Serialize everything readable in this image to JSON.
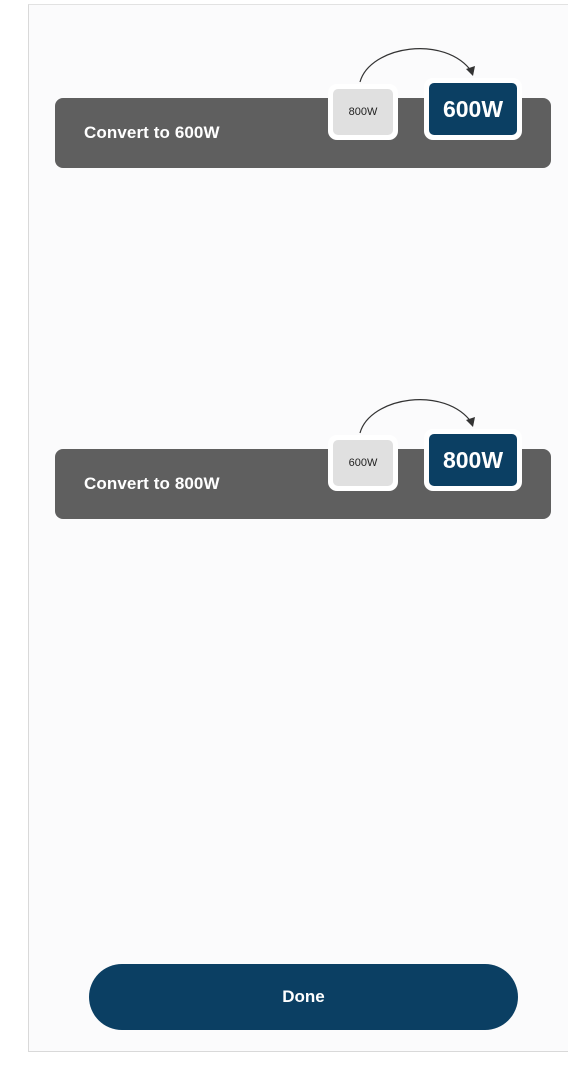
{
  "options": [
    {
      "label": "Convert to 600W",
      "from": "800W",
      "to": "600W"
    },
    {
      "label": "Convert to 800W",
      "from": "600W",
      "to": "800W"
    }
  ],
  "done_label": "Done",
  "colors": {
    "card": "#5f5f5f",
    "accent": "#0b3f63",
    "badge_light": "#e0e0e0",
    "background": "#fbfbfc"
  },
  "icons": {
    "arrow": "curved-arrow-icon"
  }
}
